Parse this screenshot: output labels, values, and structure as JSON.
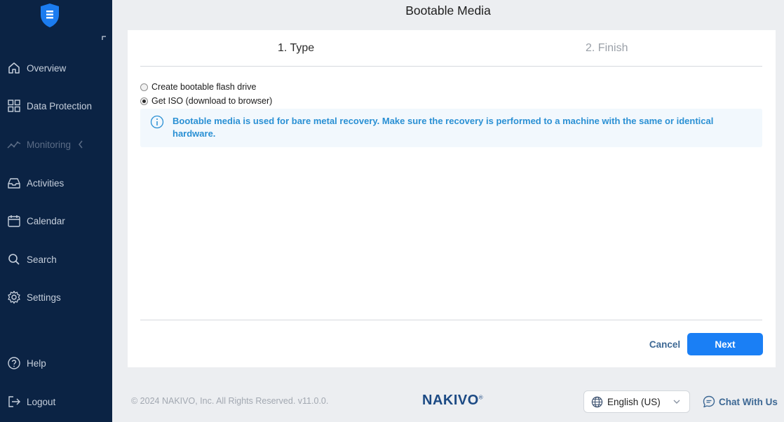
{
  "header": {
    "title": "Bootable Media"
  },
  "sidebar": {
    "items": [
      {
        "label": "Overview",
        "icon": "home-icon"
      },
      {
        "label": "Data Protection",
        "icon": "grid-icon"
      },
      {
        "label": "Monitoring",
        "icon": "chart-line-icon",
        "disabled": true
      },
      {
        "label": "Activities",
        "icon": "inbox-icon"
      },
      {
        "label": "Calendar",
        "icon": "calendar-icon"
      },
      {
        "label": "Search",
        "icon": "search-icon"
      },
      {
        "label": "Settings",
        "icon": "gear-icon"
      }
    ],
    "bottom": [
      {
        "label": "Help",
        "icon": "help-icon"
      },
      {
        "label": "Logout",
        "icon": "logout-icon"
      }
    ]
  },
  "wizard": {
    "steps": [
      "1. Type",
      "2. Finish"
    ],
    "active_step": 1,
    "options": [
      {
        "label": "Create bootable flash drive",
        "selected": false
      },
      {
        "label": "Get ISO (download to browser)",
        "selected": true
      }
    ],
    "info": "Bootable media is used for bare metal recovery. Make sure the recovery is performed to a machine with the same or identical hardware.",
    "cancel_label": "Cancel",
    "next_label": "Next"
  },
  "footer": {
    "copyright": "© 2024 NAKIVO, Inc. All Rights Reserved. v11.0.0.",
    "brand": "NAKIVO",
    "brand_mark": "®",
    "language": "English (US)",
    "chat_label": "Chat With Us"
  },
  "colors": {
    "sidebar_bg": "#0b2344",
    "accent": "#1a7ff5",
    "info_text": "#2a90d4",
    "brand": "#1c4a84"
  }
}
